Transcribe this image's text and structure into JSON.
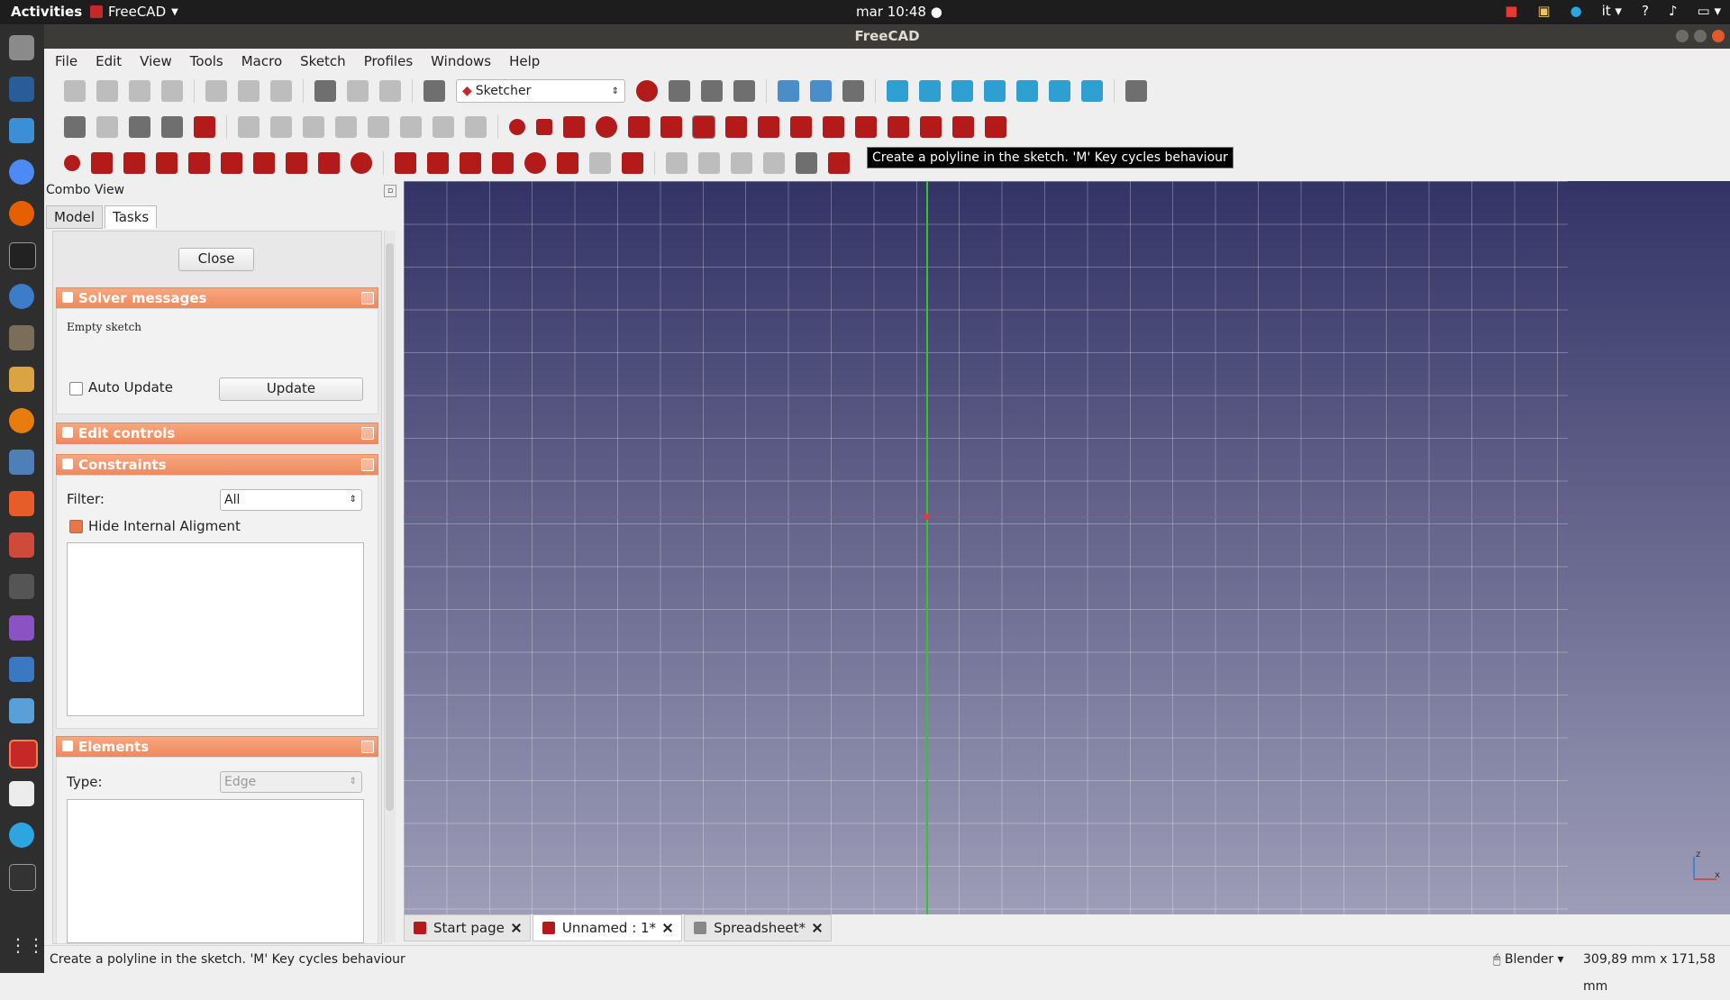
{
  "topbar": {
    "activities": "Activities",
    "app_name": "FreeCAD",
    "clock": "mar 10:48",
    "lang": "it",
    "help": "?"
  },
  "window": {
    "title": "FreeCAD"
  },
  "menubar": {
    "items": [
      "File",
      "Edit",
      "View",
      "Tools",
      "Macro",
      "Sketch",
      "Profiles",
      "Windows",
      "Help"
    ]
  },
  "toolbar": {
    "workbench": "Sketcher"
  },
  "tooltip": "Create a polyline in the sketch. 'M' Key cycles behaviour",
  "combo": {
    "title": "Combo View",
    "tabs": [
      "Model",
      "Tasks"
    ],
    "close_label": "Close",
    "solver": {
      "title": "Solver messages",
      "message": "Empty sketch",
      "auto_update": "Auto Update",
      "update": "Update"
    },
    "edit_controls": {
      "title": "Edit controls"
    },
    "constraints": {
      "title": "Constraints",
      "filter_label": "Filter:",
      "filter_value": "All",
      "hide_internal": "Hide Internal Aligment"
    },
    "elements": {
      "title": "Elements",
      "type_label": "Type:",
      "type_value": "Edge"
    }
  },
  "doctabs": [
    {
      "label": "Start page"
    },
    {
      "label": "Unnamed : 1*"
    },
    {
      "label": "Spreadsheet*"
    }
  ],
  "status": {
    "message": "Create a polyline in the sketch. 'M' Key cycles behaviour",
    "navigation": "Blender",
    "dimensions": "309,89 mm x 171,58 mm"
  },
  "axis_labels": {
    "z": "z",
    "x": "x"
  },
  "colors": {
    "section_header": "#f0885d",
    "y_axis": "#2ec82e",
    "x_axis": "#e23b3b",
    "view_top": "#333366",
    "view_bottom": "#9d9db8"
  }
}
